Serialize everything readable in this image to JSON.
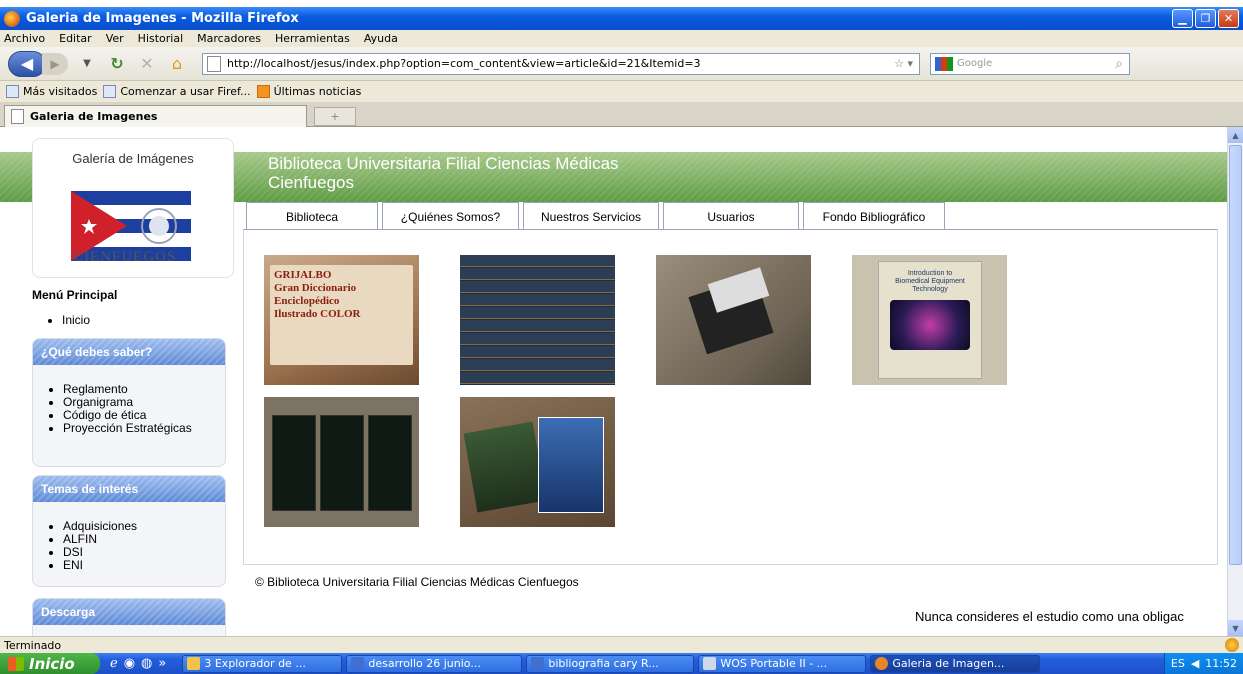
{
  "window": {
    "title": "Galeria de Imagenes - Mozilla Firefox"
  },
  "menubar": [
    "Archivo",
    "Editar",
    "Ver",
    "Historial",
    "Marcadores",
    "Herramientas",
    "Ayuda"
  ],
  "navbar": {
    "url": "http://localhost/jesus/index.php?option=com_content&view=article&id=21&Itemid=3",
    "search_placeholder": "Google"
  },
  "bookmarks": [
    "Más visitados",
    "Comenzar a usar Firef...",
    "Últimas noticias"
  ],
  "tab": {
    "title": "Galeria de Imagenes"
  },
  "page": {
    "logo_caption": "Galería de Imágenes",
    "site_title_line1": "Biblioteca Universitaria Filial Ciencias Médicas",
    "site_title_line2": "Cienfuegos",
    "logo_text": "CIENFUEGOS",
    "menu_title": "Menú Principal",
    "menu_items": [
      "Inicio"
    ],
    "box1": {
      "title": "¿Qué debes saber?",
      "items": [
        "Reglamento",
        "Organigrama",
        "Código de ética",
        "Proyección Estratégicas"
      ]
    },
    "box2": {
      "title": "Temas de interés",
      "items": [
        "Adquisiciones",
        "ALFIN",
        "DSI",
        "ENI"
      ]
    },
    "box3": {
      "title": "Descarga"
    },
    "nav_tabs": [
      "Biblioteca",
      "¿Quiénes Somos?",
      "Nuestros Servicios",
      "Usuarios",
      "Fondo Bibliográfico"
    ],
    "images": [
      {
        "caption_lines": [
          "GRIJALBO",
          "Gran Diccionario",
          "Enciclopédico",
          "Ilustrado COLOR"
        ]
      },
      {
        "caption_lines": []
      },
      {
        "caption_lines": []
      },
      {
        "caption_lines": [
          "Introduction to",
          "Biomedical Equipment",
          "Technology"
        ]
      },
      {
        "caption_lines": []
      },
      {
        "caption_lines": []
      }
    ],
    "footer": "© Biblioteca Universitaria Filial Ciencias Médicas Cienfuegos",
    "quote": "Nunca consideres el estudio como una obligac"
  },
  "status": {
    "text": "Terminado"
  },
  "taskbar": {
    "start": "Inicio",
    "tasks": [
      "3 Explorador de ...",
      "desarrollo 26 junio...",
      "bibliografia cary R...",
      "WOS Portable II - ...",
      "Galeria de Imagen..."
    ],
    "lang": "ES",
    "clock": "11:52"
  }
}
